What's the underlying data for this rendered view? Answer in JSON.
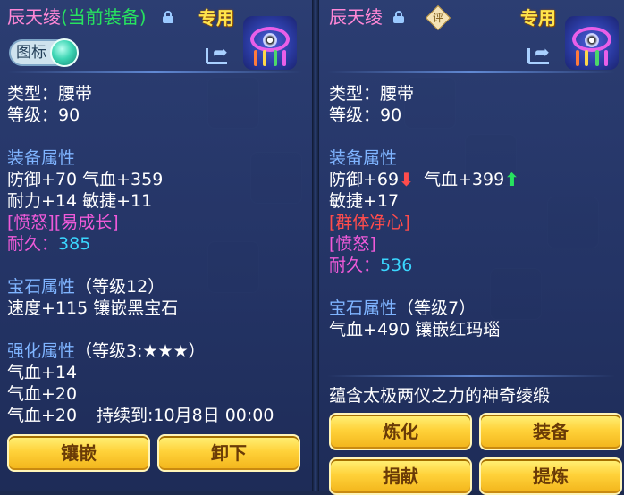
{
  "colors": {
    "name": "#ff87d6",
    "current_equipped": "#27e35f",
    "section": "#7fb4ff",
    "special": "#f05ad9",
    "durability": "#3ad7ff",
    "red_text": "#ff4c4c",
    "button": "#ffd23a"
  },
  "left_panel": {
    "item_name": "辰天绫",
    "equipped_tag": "(当前装备)",
    "exclusive_label": "专用",
    "icon_toggle_label": "图标",
    "type_line": "类型：腰带",
    "level_line": "等级：90",
    "equip_attr_title": "装备属性",
    "attr_line1": "防御+70 气血+359",
    "attr_line2": "耐力+14 敏捷+11",
    "special_effects": "[愤怒][易成长]",
    "durability_label": "耐久：",
    "durability_value": "385",
    "gem_title": "宝石属性",
    "gem_level": "（等级12）",
    "gem_line": "速度+115 镶嵌黑宝石",
    "enhance_title": "强化属性",
    "enhance_level": "（等级3:★★★）",
    "enhance_line1": "气血+14",
    "enhance_line2": "气血+20",
    "enhance_line3": "气血+20",
    "duration_line": "持续到:10月8日 00:00",
    "button_inlay": "镶嵌",
    "button_unequip": "卸下"
  },
  "right_panel": {
    "item_name": "辰天绫",
    "rating_label": "评",
    "exclusive_label": "专用",
    "type_line": "类型：腰带",
    "level_line": "等级：90",
    "equip_attr_title": "装备属性",
    "attr_defense": "防御+69",
    "attr_hp": "气血+399",
    "attr_agility": "敏捷+17",
    "special_effect1": "[群体净心]",
    "special_effect2": "[愤怒]",
    "durability_label": "耐久：",
    "durability_value": "536",
    "gem_title": "宝石属性",
    "gem_level": "（等级7）",
    "gem_line": "气血+490 镶嵌红玛瑙",
    "description": "蕴含太极两仪之力的神奇绫缎",
    "button_refine": "炼化",
    "button_equip": "装备",
    "button_donate": "捐献",
    "button_extract": "提炼"
  }
}
